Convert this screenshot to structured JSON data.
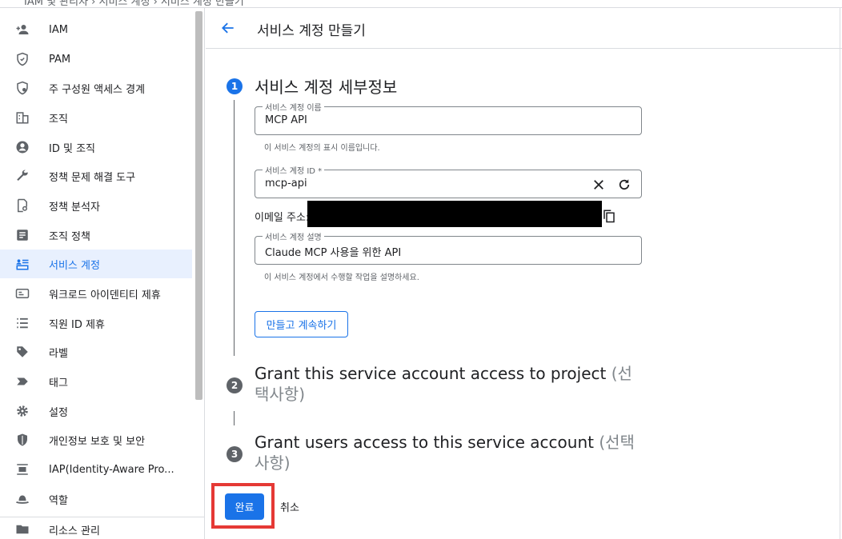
{
  "topbar": {
    "cut_text": "IAM 및 관리자 › 서비스 계정 › 서비스 계정 만들기"
  },
  "sidebar": {
    "items": [
      {
        "label": "IAM",
        "icon": "person-add-icon"
      },
      {
        "label": "PAM",
        "icon": "shield-icon"
      },
      {
        "label": "주 구성원 액세스 경계",
        "icon": "policy-shield-icon"
      },
      {
        "label": "조직",
        "icon": "building-icon"
      },
      {
        "label": "ID 및 조직",
        "icon": "account-circle-icon"
      },
      {
        "label": "정책 문제 해결 도구",
        "icon": "wrench-icon"
      },
      {
        "label": "정책 분석자",
        "icon": "document-search-icon"
      },
      {
        "label": "조직 정책",
        "icon": "article-icon"
      },
      {
        "label": "서비스 계정",
        "icon": "service-account-icon",
        "active": true
      },
      {
        "label": "워크로드 아이덴티티 제휴",
        "icon": "id-card-icon"
      },
      {
        "label": "직원 ID 제휴",
        "icon": "list-icon"
      },
      {
        "label": "라벨",
        "icon": "tag-icon"
      },
      {
        "label": "태그",
        "icon": "label-arrow-icon"
      },
      {
        "label": "설정",
        "icon": "gear-icon"
      },
      {
        "label": "개인정보 보호 및 보안",
        "icon": "security-shield-icon"
      },
      {
        "label": "IAP(Identity-Aware Pro...",
        "icon": "iap-icon"
      },
      {
        "label": "역할",
        "icon": "hat-icon"
      },
      {
        "label": "리소스 관리",
        "icon": "folder-icon"
      }
    ]
  },
  "header": {
    "title": "서비스 계정 만들기"
  },
  "step1": {
    "number": "1",
    "title": "서비스 계정 세부정보",
    "name_field": {
      "label": "서비스 계정 이름",
      "value": "MCP API",
      "hint": "이 서비스 계정의 표시 이름입니다."
    },
    "id_field": {
      "label": "서비스 계정 ID *",
      "value": "mcp-api"
    },
    "email_label": "이메일 주소:",
    "desc_field": {
      "label": "서비스 계정 설명",
      "value": "Claude MCP 사용을 위한 API",
      "hint": "이 서비스 계정에서 수행할 작업을 설명하세요."
    },
    "continue_button": "만들고 계속하기"
  },
  "step2": {
    "number": "2",
    "title_main": "Grant this service account access to project",
    "title_opt": "(선택사항)"
  },
  "step3": {
    "number": "3",
    "title_main": "Grant users access to this service account",
    "title_opt": "(선택사항)"
  },
  "actions": {
    "done": "완료",
    "cancel": "취소"
  },
  "colors": {
    "accent": "#1a73e8",
    "highlight": "#e53935"
  }
}
